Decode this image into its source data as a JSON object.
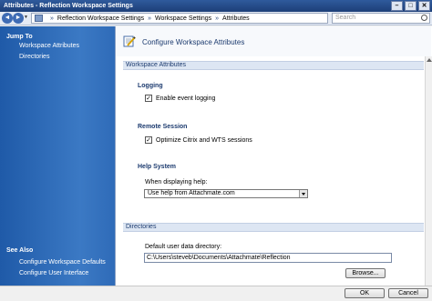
{
  "window": {
    "title": "Attributes - Reflection Workspace Settings"
  },
  "title_buttons": {
    "minimize": "–",
    "maximize": "□",
    "close": "✕"
  },
  "nav": {
    "back": "◄",
    "forward": "►",
    "dropdown": "▼",
    "breadcrumb": [
      "Reflection Workspace Settings",
      "Workspace Settings",
      "Attributes"
    ],
    "separator": "»",
    "search_placeholder": "Search"
  },
  "sidebar": {
    "jump_to": "Jump To",
    "links": [
      "Workspace Attributes",
      "Directories"
    ],
    "see_also": "See Also",
    "see_also_links": [
      "Configure Workspace Defaults",
      "Configure User Interface"
    ]
  },
  "main": {
    "title": "Configure Workspace Attributes",
    "section_workspace": "Workspace Attributes",
    "logging": {
      "title": "Logging",
      "checkbox_label": "Enable event logging",
      "checked": true
    },
    "remote": {
      "title": "Remote Session",
      "checkbox_label": "Optimize Citrix and WTS sessions",
      "checked": true
    },
    "help": {
      "title": "Help System",
      "label": "When displaying help:",
      "selected": "Use help from Attachmate.com"
    },
    "section_directories": "Directories",
    "directories": {
      "label": "Default user data directory:",
      "value": "C:\\Users\\steveb\\Documents\\Attachmate\\Reflection",
      "browse": "Browse..."
    }
  },
  "footer": {
    "ok": "OK",
    "cancel": "Cancel"
  },
  "icons": {
    "check_glyph": "✓"
  }
}
